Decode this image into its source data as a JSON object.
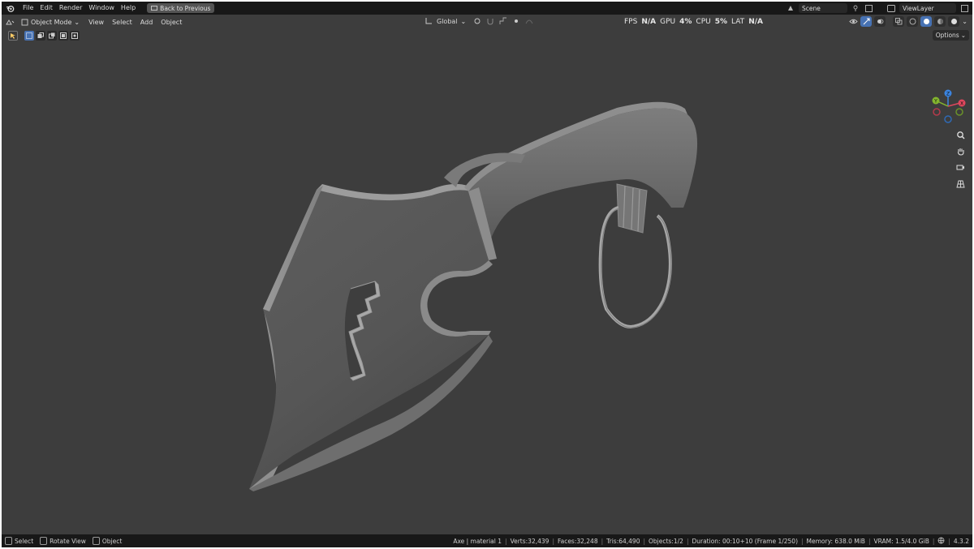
{
  "topbar": {
    "menus": [
      "File",
      "Edit",
      "Render",
      "Window",
      "Help"
    ],
    "back_button": "Back to Previous",
    "scene": "Scene",
    "view_layer": "ViewLayer"
  },
  "header": {
    "mode": "Object Mode",
    "menus": [
      "View",
      "Select",
      "Add",
      "Object"
    ],
    "orientation": "Global",
    "stats": {
      "fps_label": "FPS",
      "fps_value": "N/A",
      "gpu_label": "GPU",
      "gpu_value": "4%",
      "cpu_label": "CPU",
      "cpu_value": "5%",
      "lat_label": "LAT",
      "lat_value": "N/A"
    }
  },
  "toolbar": {
    "options_label": "Options"
  },
  "gizmo": {
    "x_label": "X",
    "y_label": "Y",
    "z_label": "Z"
  },
  "statusbar": {
    "hints": [
      "Select",
      "Rotate View",
      "Object"
    ],
    "info": [
      "Axe | material 1",
      "Verts:32,439",
      "Faces:32,248",
      "Tris:64,490",
      "Objects:1/2",
      "Duration: 00:10+10 (Frame 1/250)",
      "Memory: 638.0 MiB",
      "VRAM: 1.5/4.0 GiB",
      "4.3.2"
    ]
  },
  "colors": {
    "viewport_bg": "#3d3d3d",
    "topbar_bg": "#181818",
    "accent": "#4772b3",
    "axis_x": "#e0475d",
    "axis_y": "#84b62e",
    "axis_z": "#3b84e0"
  }
}
